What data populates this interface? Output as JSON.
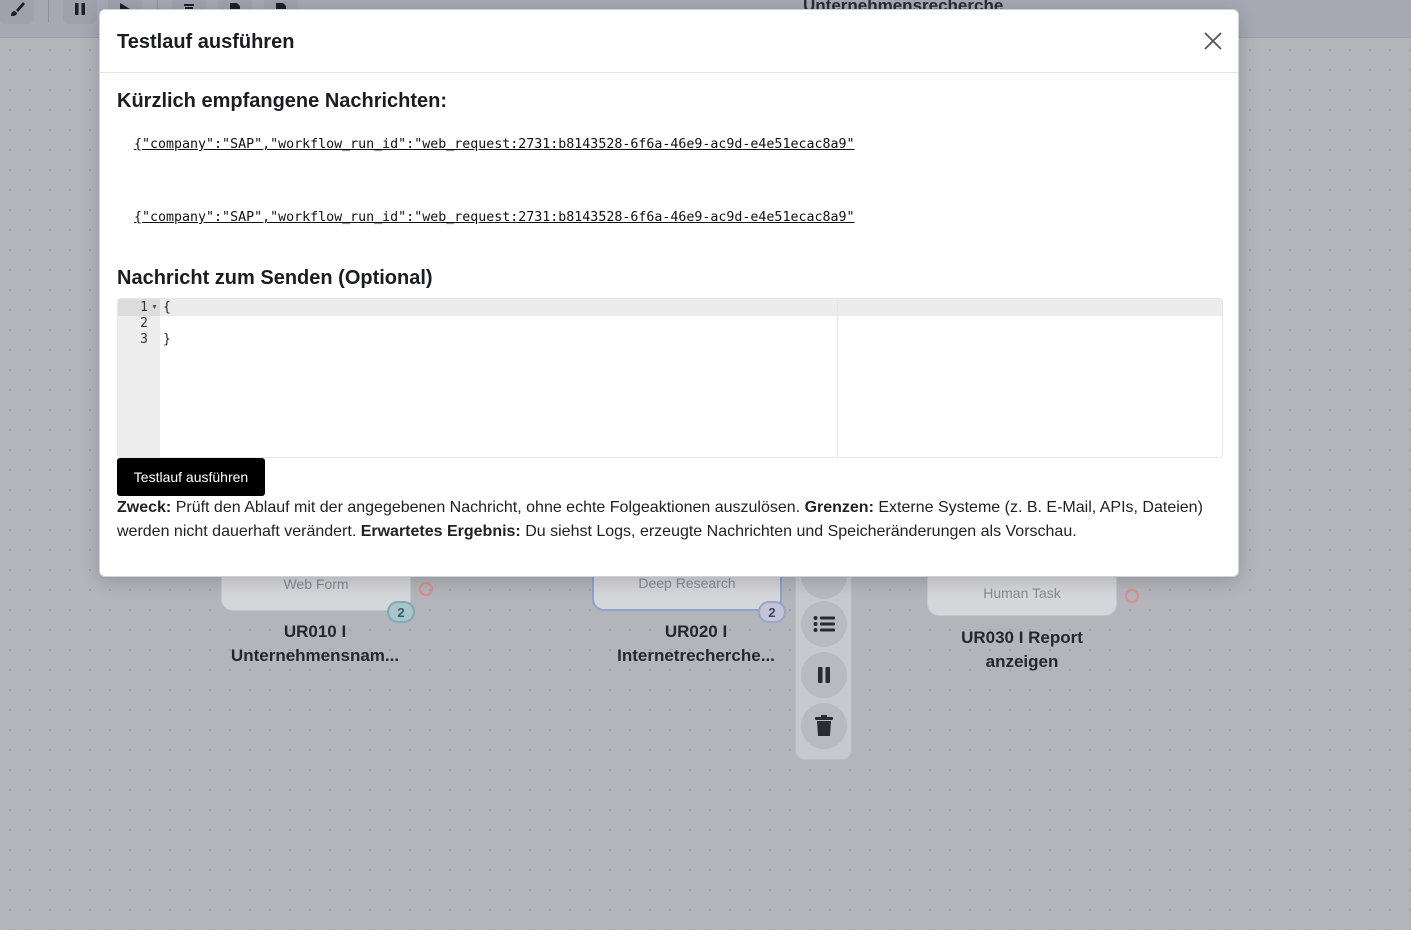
{
  "toolbar": {
    "workflow_title": "Unternehmensrecherche",
    "buttons": [
      "brush-icon",
      "pause-icon",
      "play-icon",
      "trash-icon",
      "file-export-icon",
      "file-import-icon"
    ]
  },
  "canvas": {
    "nodes": [
      {
        "type": "Web Form",
        "badge": "2",
        "label_line1": "UR010 I",
        "label_line2": "Unternehmensnam..."
      },
      {
        "type": "Deep Research",
        "badge": "2",
        "label_line1": "UR020 I",
        "label_line2": "Internetrecherche..."
      },
      {
        "type": "Human Task",
        "label_line1": "UR030 I Report",
        "label_line2": "anzeigen"
      }
    ]
  },
  "modal": {
    "title": "Testlauf ausführen",
    "recent_heading": "Kürzlich empfangene Nachrichten:",
    "messages": [
      "{\"company\":\"SAP\",\"workflow_run_id\":\"web_request:2731:b8143528-6f6a-46e9-ac9d-e4e51ecac8a9\"",
      "{\"company\":\"SAP\",\"workflow_run_id\":\"web_request:2731:b8143528-6f6a-46e9-ac9d-e4e51ecac8a9\""
    ],
    "send_heading": "Nachricht zum Senden (Optional)",
    "editor": {
      "line_numbers": [
        "1",
        "2",
        "3"
      ],
      "lines": [
        "{",
        "",
        "}"
      ]
    },
    "run_button": "Testlauf ausführen",
    "description": {
      "purpose_label": "Zweck:",
      "purpose_text": " Prüft den Ablauf mit der angegebenen Nachricht, ohne echte Folgeaktionen auszulösen. ",
      "limits_label": "Grenzen:",
      "limits_text": " Externe Systeme (z. B. E-Mail, APIs, Dateien) werden nicht dauerhaft verändert. ",
      "result_label": "Erwartetes Ergebnis:",
      "result_text": " Du siehst Logs, erzeugte Nachrichten und Speicheränderungen als Vorschau."
    }
  }
}
